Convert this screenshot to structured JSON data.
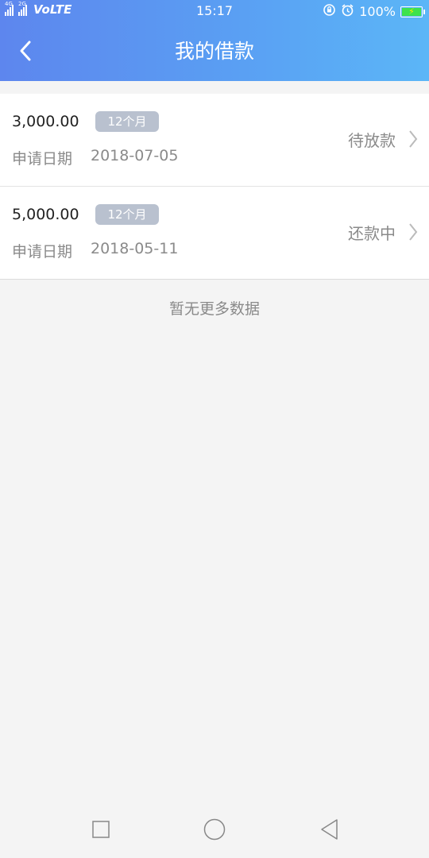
{
  "status_bar": {
    "network_tag_1": "4G",
    "network_tag_2": "2G",
    "volte": "VoLTE",
    "time": "15:17",
    "battery": "100%",
    "icons": [
      "signal-icon",
      "lock-rotation-icon",
      "alarm-icon",
      "battery-icon"
    ]
  },
  "header": {
    "title": "我的借款",
    "back_icon": "chevron-left-icon"
  },
  "loans": [
    {
      "amount": "3,000.00",
      "term": "12个月",
      "date_label": "申请日期",
      "date": "2018-07-05",
      "status": "待放款"
    },
    {
      "amount": "5,000.00",
      "term": "12个月",
      "date_label": "申请日期",
      "date": "2018-05-11",
      "status": "还款中"
    }
  ],
  "footer_text": "暂无更多数据",
  "nav": {
    "buttons": [
      "recent-apps-icon",
      "home-icon",
      "back-triangle-icon"
    ]
  },
  "colors": {
    "header_gradient_start": "#5d86ee",
    "header_gradient_end": "#5bb6f7",
    "badge": "#b9c1cf",
    "background": "#f4f4f4",
    "battery_fill": "#3ee24d"
  }
}
